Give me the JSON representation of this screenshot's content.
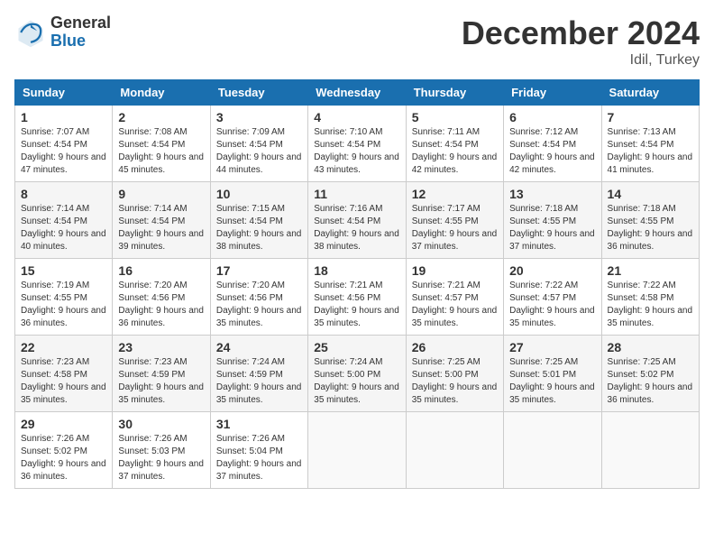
{
  "logo": {
    "general": "General",
    "blue": "Blue"
  },
  "title": "December 2024",
  "location": "Idil, Turkey",
  "weekdays": [
    "Sunday",
    "Monday",
    "Tuesday",
    "Wednesday",
    "Thursday",
    "Friday",
    "Saturday"
  ],
  "weeks": [
    [
      {
        "day": "1",
        "sunrise": "Sunrise: 7:07 AM",
        "sunset": "Sunset: 4:54 PM",
        "daylight": "Daylight: 9 hours and 47 minutes."
      },
      {
        "day": "2",
        "sunrise": "Sunrise: 7:08 AM",
        "sunset": "Sunset: 4:54 PM",
        "daylight": "Daylight: 9 hours and 45 minutes."
      },
      {
        "day": "3",
        "sunrise": "Sunrise: 7:09 AM",
        "sunset": "Sunset: 4:54 PM",
        "daylight": "Daylight: 9 hours and 44 minutes."
      },
      {
        "day": "4",
        "sunrise": "Sunrise: 7:10 AM",
        "sunset": "Sunset: 4:54 PM",
        "daylight": "Daylight: 9 hours and 43 minutes."
      },
      {
        "day": "5",
        "sunrise": "Sunrise: 7:11 AM",
        "sunset": "Sunset: 4:54 PM",
        "daylight": "Daylight: 9 hours and 42 minutes."
      },
      {
        "day": "6",
        "sunrise": "Sunrise: 7:12 AM",
        "sunset": "Sunset: 4:54 PM",
        "daylight": "Daylight: 9 hours and 42 minutes."
      },
      {
        "day": "7",
        "sunrise": "Sunrise: 7:13 AM",
        "sunset": "Sunset: 4:54 PM",
        "daylight": "Daylight: 9 hours and 41 minutes."
      }
    ],
    [
      {
        "day": "8",
        "sunrise": "Sunrise: 7:14 AM",
        "sunset": "Sunset: 4:54 PM",
        "daylight": "Daylight: 9 hours and 40 minutes."
      },
      {
        "day": "9",
        "sunrise": "Sunrise: 7:14 AM",
        "sunset": "Sunset: 4:54 PM",
        "daylight": "Daylight: 9 hours and 39 minutes."
      },
      {
        "day": "10",
        "sunrise": "Sunrise: 7:15 AM",
        "sunset": "Sunset: 4:54 PM",
        "daylight": "Daylight: 9 hours and 38 minutes."
      },
      {
        "day": "11",
        "sunrise": "Sunrise: 7:16 AM",
        "sunset": "Sunset: 4:54 PM",
        "daylight": "Daylight: 9 hours and 38 minutes."
      },
      {
        "day": "12",
        "sunrise": "Sunrise: 7:17 AM",
        "sunset": "Sunset: 4:55 PM",
        "daylight": "Daylight: 9 hours and 37 minutes."
      },
      {
        "day": "13",
        "sunrise": "Sunrise: 7:18 AM",
        "sunset": "Sunset: 4:55 PM",
        "daylight": "Daylight: 9 hours and 37 minutes."
      },
      {
        "day": "14",
        "sunrise": "Sunrise: 7:18 AM",
        "sunset": "Sunset: 4:55 PM",
        "daylight": "Daylight: 9 hours and 36 minutes."
      }
    ],
    [
      {
        "day": "15",
        "sunrise": "Sunrise: 7:19 AM",
        "sunset": "Sunset: 4:55 PM",
        "daylight": "Daylight: 9 hours and 36 minutes."
      },
      {
        "day": "16",
        "sunrise": "Sunrise: 7:20 AM",
        "sunset": "Sunset: 4:56 PM",
        "daylight": "Daylight: 9 hours and 36 minutes."
      },
      {
        "day": "17",
        "sunrise": "Sunrise: 7:20 AM",
        "sunset": "Sunset: 4:56 PM",
        "daylight": "Daylight: 9 hours and 35 minutes."
      },
      {
        "day": "18",
        "sunrise": "Sunrise: 7:21 AM",
        "sunset": "Sunset: 4:56 PM",
        "daylight": "Daylight: 9 hours and 35 minutes."
      },
      {
        "day": "19",
        "sunrise": "Sunrise: 7:21 AM",
        "sunset": "Sunset: 4:57 PM",
        "daylight": "Daylight: 9 hours and 35 minutes."
      },
      {
        "day": "20",
        "sunrise": "Sunrise: 7:22 AM",
        "sunset": "Sunset: 4:57 PM",
        "daylight": "Daylight: 9 hours and 35 minutes."
      },
      {
        "day": "21",
        "sunrise": "Sunrise: 7:22 AM",
        "sunset": "Sunset: 4:58 PM",
        "daylight": "Daylight: 9 hours and 35 minutes."
      }
    ],
    [
      {
        "day": "22",
        "sunrise": "Sunrise: 7:23 AM",
        "sunset": "Sunset: 4:58 PM",
        "daylight": "Daylight: 9 hours and 35 minutes."
      },
      {
        "day": "23",
        "sunrise": "Sunrise: 7:23 AM",
        "sunset": "Sunset: 4:59 PM",
        "daylight": "Daylight: 9 hours and 35 minutes."
      },
      {
        "day": "24",
        "sunrise": "Sunrise: 7:24 AM",
        "sunset": "Sunset: 4:59 PM",
        "daylight": "Daylight: 9 hours and 35 minutes."
      },
      {
        "day": "25",
        "sunrise": "Sunrise: 7:24 AM",
        "sunset": "Sunset: 5:00 PM",
        "daylight": "Daylight: 9 hours and 35 minutes."
      },
      {
        "day": "26",
        "sunrise": "Sunrise: 7:25 AM",
        "sunset": "Sunset: 5:00 PM",
        "daylight": "Daylight: 9 hours and 35 minutes."
      },
      {
        "day": "27",
        "sunrise": "Sunrise: 7:25 AM",
        "sunset": "Sunset: 5:01 PM",
        "daylight": "Daylight: 9 hours and 35 minutes."
      },
      {
        "day": "28",
        "sunrise": "Sunrise: 7:25 AM",
        "sunset": "Sunset: 5:02 PM",
        "daylight": "Daylight: 9 hours and 36 minutes."
      }
    ],
    [
      {
        "day": "29",
        "sunrise": "Sunrise: 7:26 AM",
        "sunset": "Sunset: 5:02 PM",
        "daylight": "Daylight: 9 hours and 36 minutes."
      },
      {
        "day": "30",
        "sunrise": "Sunrise: 7:26 AM",
        "sunset": "Sunset: 5:03 PM",
        "daylight": "Daylight: 9 hours and 37 minutes."
      },
      {
        "day": "31",
        "sunrise": "Sunrise: 7:26 AM",
        "sunset": "Sunset: 5:04 PM",
        "daylight": "Daylight: 9 hours and 37 minutes."
      },
      null,
      null,
      null,
      null
    ]
  ]
}
